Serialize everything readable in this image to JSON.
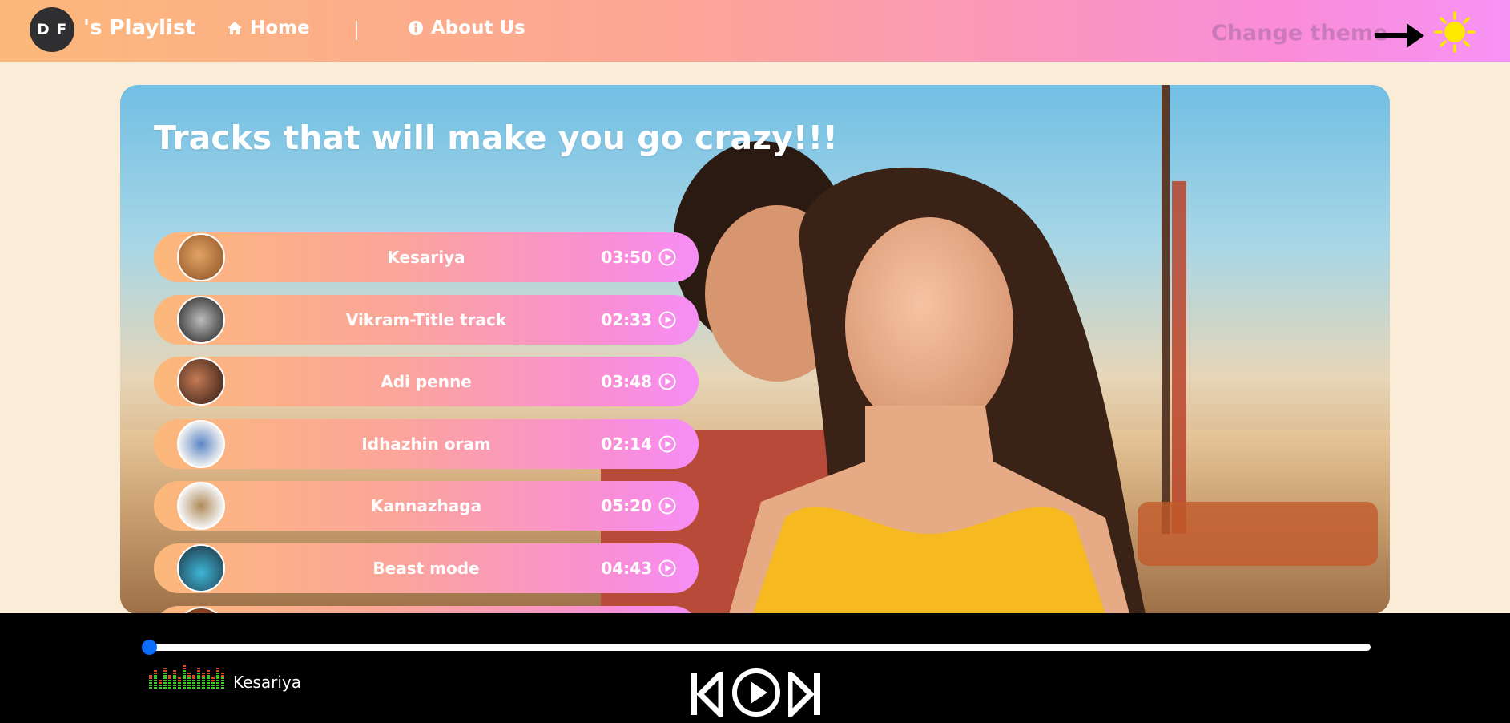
{
  "header": {
    "logo_text": "D F",
    "brand": "'s Playlist",
    "nav": [
      {
        "label": "Home",
        "icon": "home-icon"
      },
      {
        "label": "About Us",
        "icon": "info-icon"
      }
    ],
    "theme_label": "Change theme",
    "theme_icon": "sun-icon"
  },
  "main": {
    "title": "Tracks that will make you go crazy!!!",
    "tracks": [
      {
        "name": "Kesariya",
        "duration": "03:50"
      },
      {
        "name": "Vikram-Title track",
        "duration": "02:33"
      },
      {
        "name": "Adi penne",
        "duration": "03:48"
      },
      {
        "name": "Idhazhin oram",
        "duration": "02:14"
      },
      {
        "name": "Kannazhaga",
        "duration": "05:20"
      },
      {
        "name": "Beast mode",
        "duration": "04:43"
      }
    ]
  },
  "player": {
    "progress": 0.0,
    "now_playing": "Kesariya",
    "controls": [
      "previous-icon",
      "play-icon",
      "next-icon"
    ]
  },
  "colors": {
    "gradient_start": "#fcb87a",
    "gradient_end": "#f793f5",
    "page_bg": "#fbecd8",
    "player_bg": "#000000",
    "progress_accent": "#0d6efd",
    "sun": "#ffe800"
  }
}
